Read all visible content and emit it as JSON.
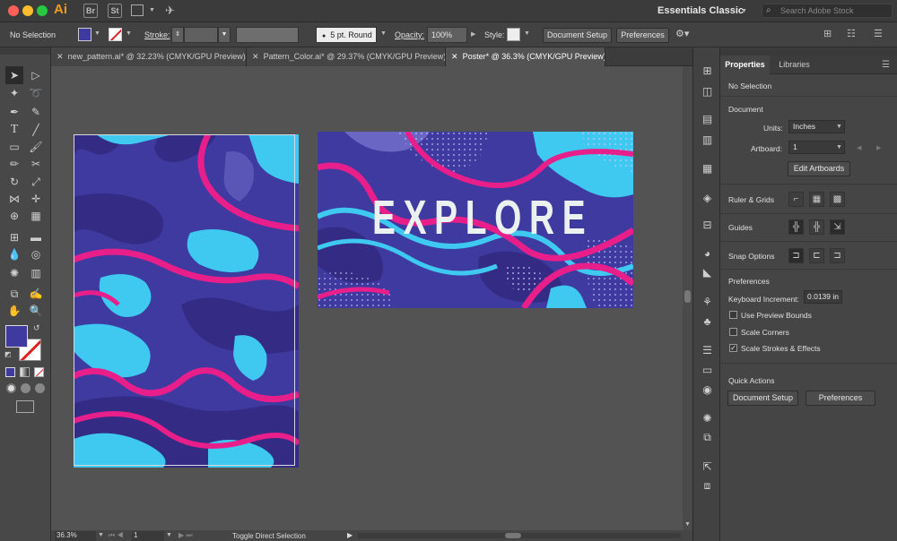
{
  "app": {
    "logo": "Ai",
    "bridge": "Br",
    "stock": "St",
    "workspace": "Essentials Classic",
    "search_placeholder": "Search Adobe Stock"
  },
  "control": {
    "selection": "No Selection",
    "stroke_label": "Stroke:",
    "brush": "5 pt. Round",
    "opacity_label": "Opacity:",
    "opacity_value": "100%",
    "style_label": "Style:",
    "doc_setup": "Document Setup",
    "preferences": "Preferences"
  },
  "tabs": [
    {
      "label": "new_pattern.ai* @ 32.23% (CMYK/GPU Preview)"
    },
    {
      "label": "Pattern_Color.ai* @ 29.37% (CMYK/GPU Preview)"
    },
    {
      "label": "Poster* @ 36.3% (CMYK/GPU Preview)"
    }
  ],
  "artwork": {
    "headline": "EXPLORE"
  },
  "status": {
    "zoom": "36.3%",
    "artboard": "1",
    "tool": "Toggle Direct Selection"
  },
  "panel": {
    "tab_properties": "Properties",
    "tab_libraries": "Libraries",
    "selection": "No Selection",
    "document": "Document",
    "units_label": "Units:",
    "units_value": "Inches",
    "artboard_label": "Artboard:",
    "artboard_value": "1",
    "edit_artboards": "Edit Artboards",
    "rulers": "Ruler & Grids",
    "guides": "Guides",
    "snap": "Snap Options",
    "preferences": "Preferences",
    "keyboard_label": "Keyboard Increment:",
    "keyboard_value": "0.0139 in",
    "chk_preview": "Use Preview Bounds",
    "chk_scale_corners": "Scale Corners",
    "chk_scale_strokes": "Scale Strokes & Effects",
    "quick_actions": "Quick Actions",
    "qa_doc_setup": "Document Setup",
    "qa_preferences": "Preferences"
  },
  "colors": {
    "fill": "#3e3aa0",
    "accent_pink": "#e81f8a",
    "accent_cyan": "#3fc8f0",
    "deep_purple": "#342b84"
  }
}
